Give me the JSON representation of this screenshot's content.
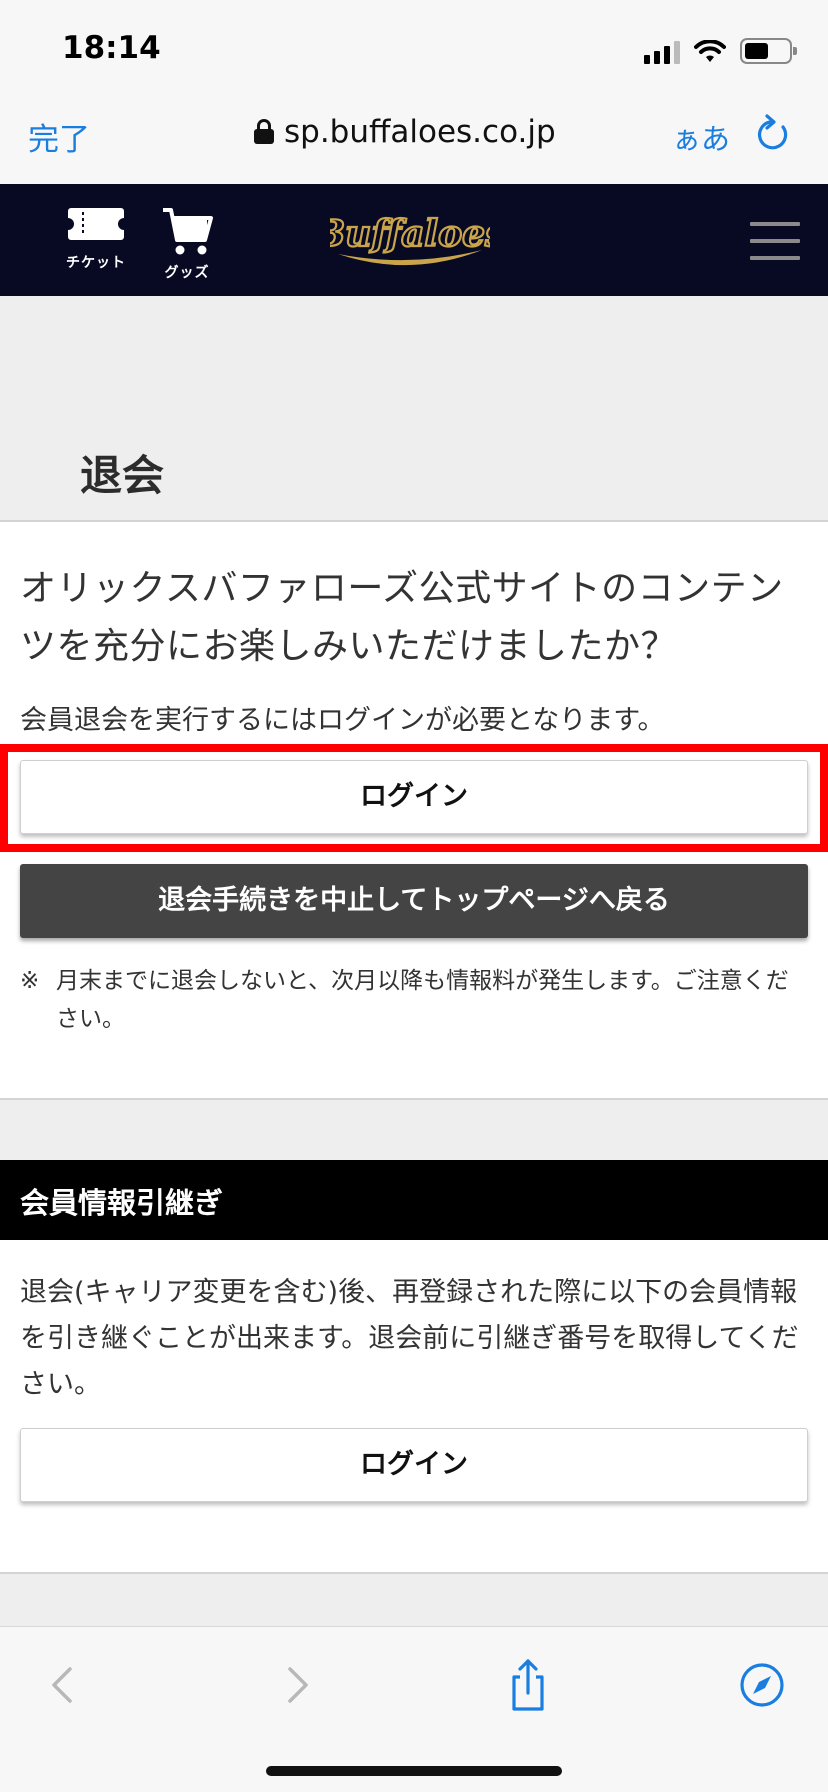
{
  "status_bar": {
    "time": "18:14"
  },
  "browser": {
    "done_label": "完了",
    "url": "sp.buffaloes.co.jp",
    "text_size_label": "ぁあ"
  },
  "site_header": {
    "ticket_label": "チケット",
    "goods_label": "グッズ",
    "logo_text": "Buffaloes"
  },
  "page": {
    "title": "退会",
    "question": "オリックスバファローズ公式サイトのコンテンツを充分にお楽しみいただけましたか？",
    "login_notice": "会員退会を実行するにはログインが必要となります。",
    "login_button": "ログイン",
    "cancel_button": "退会手続きを中止してトップページへ戻る",
    "footnote_mark": "※",
    "footnote_text": "月末までに退会しないと、次月以降も情報料が発生します。ご注意ください。"
  },
  "transfer_section": {
    "title": "会員情報引継ぎ",
    "description": "退会(キャリア変更を含む)後、再登録された際に以下の会員情報を引き継ぐことが出来ます。退会前に引継ぎ番号を取得してください。",
    "login_button": "ログイン"
  },
  "colors": {
    "header_bg": "#080a24",
    "link_blue": "#1a7ee0",
    "highlight": "#ff0000",
    "cancel_bg": "#444444",
    "logo_gold": "#c9a44a"
  }
}
